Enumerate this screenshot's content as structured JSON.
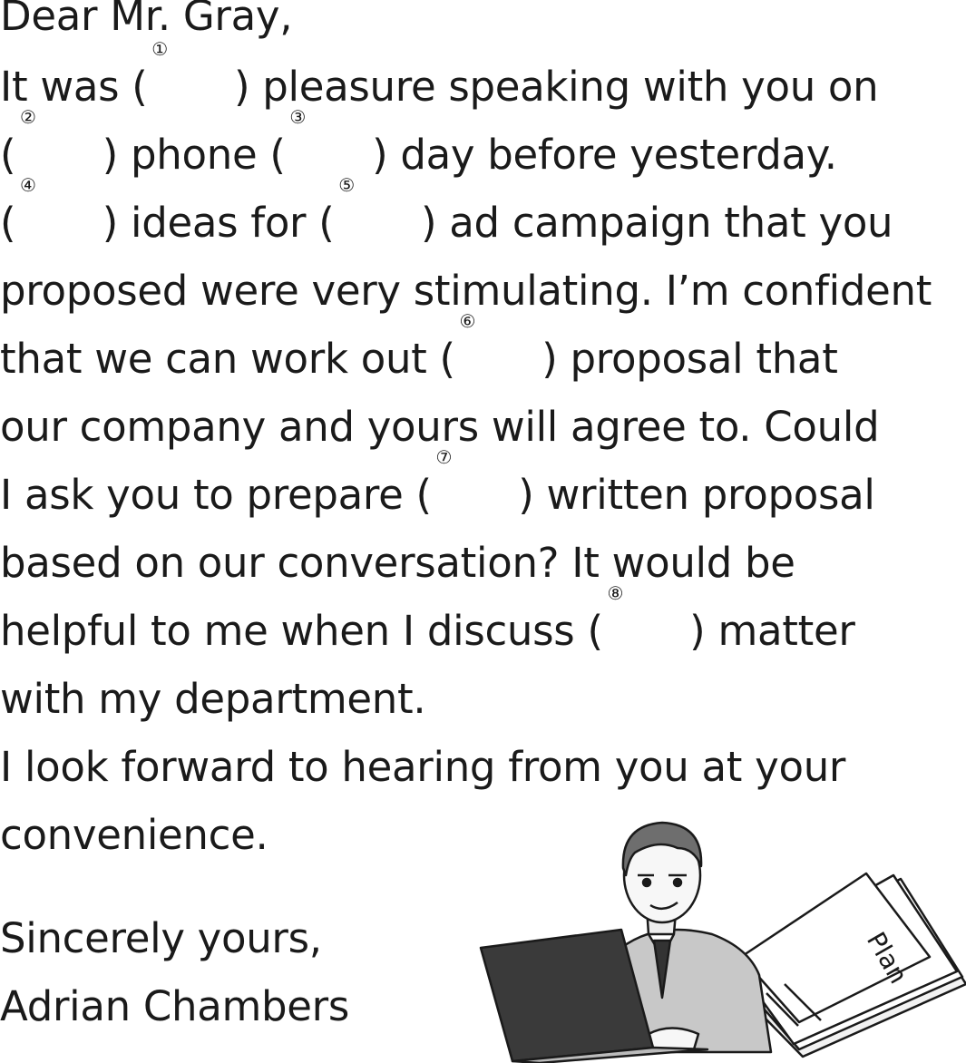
{
  "letter": {
    "salutation": "Dear Mr. Gray,",
    "l1a": "It was ",
    "l1b": " pleasure speaking with you on",
    "l2b": " phone ",
    "l2c": " day before yesterday.",
    "l3b": " ideas for ",
    "l3c": " ad campaign that you",
    "l4": "proposed were very stimulating. I’m confident",
    "l5a": "that we can work out ",
    "l5b": " proposal that",
    "l6": "our company and yours will agree to. Could",
    "l7a": "I ask you to prepare ",
    "l7b": " written proposal",
    "l8": "based on our conversation? It would be",
    "l9a": "helpful to me when I discuss ",
    "l9b": " matter",
    "l10": "with my department.",
    "l11": "I look forward to hearing from you at your",
    "l12": "convenience.",
    "closing": "Sincerely yours,",
    "signature": "Adrian Chambers"
  },
  "blanks": {
    "open": "(",
    "close": ")",
    "n1": "①",
    "n2": "②",
    "n3": "③",
    "n4": "④",
    "n5": "⑤",
    "n6": "⑥",
    "n7": "⑦",
    "n8": "⑧"
  },
  "illustration": {
    "document_label": "Plan"
  }
}
